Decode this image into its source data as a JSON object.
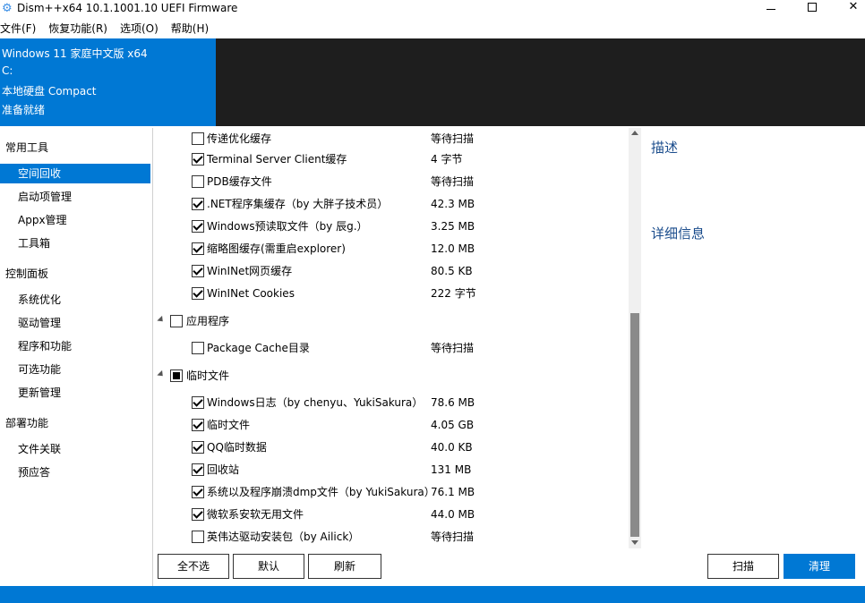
{
  "window": {
    "title": "Dism++x64 10.1.1001.10 UEFI Firmware",
    "controls": {
      "minimize": "minimize",
      "maximize": "maximize",
      "close": "✕"
    }
  },
  "menu": [
    "文件(F)",
    "恢复功能(R)",
    "选项(O)",
    "帮助(H)"
  ],
  "header": {
    "os": "Windows 11 家庭中文版 x64",
    "drive": "C:",
    "disk": "本地硬盘 Compact",
    "status": "准备就绪"
  },
  "sidebar": {
    "groups": [
      {
        "label": "常用工具",
        "items": [
          "空间回收",
          "启动项管理",
          "Appx管理",
          "工具箱"
        ]
      },
      {
        "label": "控制面板",
        "items": [
          "系统优化",
          "驱动管理",
          "程序和功能",
          "可选功能",
          "更新管理"
        ]
      },
      {
        "label": "部署功能",
        "items": [
          "文件关联",
          "预应答"
        ]
      }
    ],
    "active": "空间回收"
  },
  "list": {
    "rows": [
      {
        "label": "传递优化缓存",
        "size": "等待扫描",
        "state": "unchecked",
        "type": "item"
      },
      {
        "label": "Terminal Server Client缓存",
        "size": "4 字节",
        "state": "checked",
        "type": "item"
      },
      {
        "label": "PDB缓存文件",
        "size": "等待扫描",
        "state": "unchecked",
        "type": "item"
      },
      {
        "label": ".NET程序集缓存（by 大胖子技术员）",
        "size": "42.3 MB",
        "state": "checked",
        "type": "item"
      },
      {
        "label": "Windows预读取文件（by 辰g.）",
        "size": "3.25 MB",
        "state": "checked",
        "type": "item"
      },
      {
        "label": "缩略图缓存(需重启explorer)",
        "size": "12.0 MB",
        "state": "checked",
        "type": "item"
      },
      {
        "label": "WinINet网页缓存",
        "size": "80.5 KB",
        "state": "checked",
        "type": "item"
      },
      {
        "label": "WinINet Cookies",
        "size": "222 字节",
        "state": "checked",
        "type": "item"
      },
      {
        "label": "应用程序",
        "size": "",
        "state": "unchecked",
        "type": "group"
      },
      {
        "label": "Package Cache目录",
        "size": "等待扫描",
        "state": "unchecked",
        "type": "item"
      },
      {
        "label": "临时文件",
        "size": "",
        "state": "partial",
        "type": "group"
      },
      {
        "label": "Windows日志（by chenyu、YukiSakura）",
        "size": "78.6 MB",
        "state": "checked",
        "type": "item"
      },
      {
        "label": "临时文件",
        "size": "4.05 GB",
        "state": "checked",
        "type": "item"
      },
      {
        "label": "QQ临时数据",
        "size": "40.0 KB",
        "state": "checked",
        "type": "item"
      },
      {
        "label": "回收站",
        "size": "131 MB",
        "state": "checked",
        "type": "item"
      },
      {
        "label": "系统以及程序崩溃dmp文件（by YukiSakura）",
        "size": "76.1 MB",
        "state": "checked",
        "type": "item"
      },
      {
        "label": "微软系安软无用文件",
        "size": "44.0 MB",
        "state": "checked",
        "type": "item"
      },
      {
        "label": "英伟达驱动安装包（by Ailick）",
        "size": "等待扫描",
        "state": "unchecked",
        "type": "item"
      }
    ]
  },
  "details": {
    "description_title": "描述",
    "details_title": "详细信息"
  },
  "buttons": {
    "deselect_all": "全不选",
    "default": "默认",
    "refresh": "刷新",
    "scan": "扫描",
    "clean": "清理"
  },
  "scroll": {
    "position": 0.75
  },
  "colors": {
    "accent": "#0078d4",
    "header_dark": "#1e1e1e",
    "link": "#1a4c8c"
  }
}
